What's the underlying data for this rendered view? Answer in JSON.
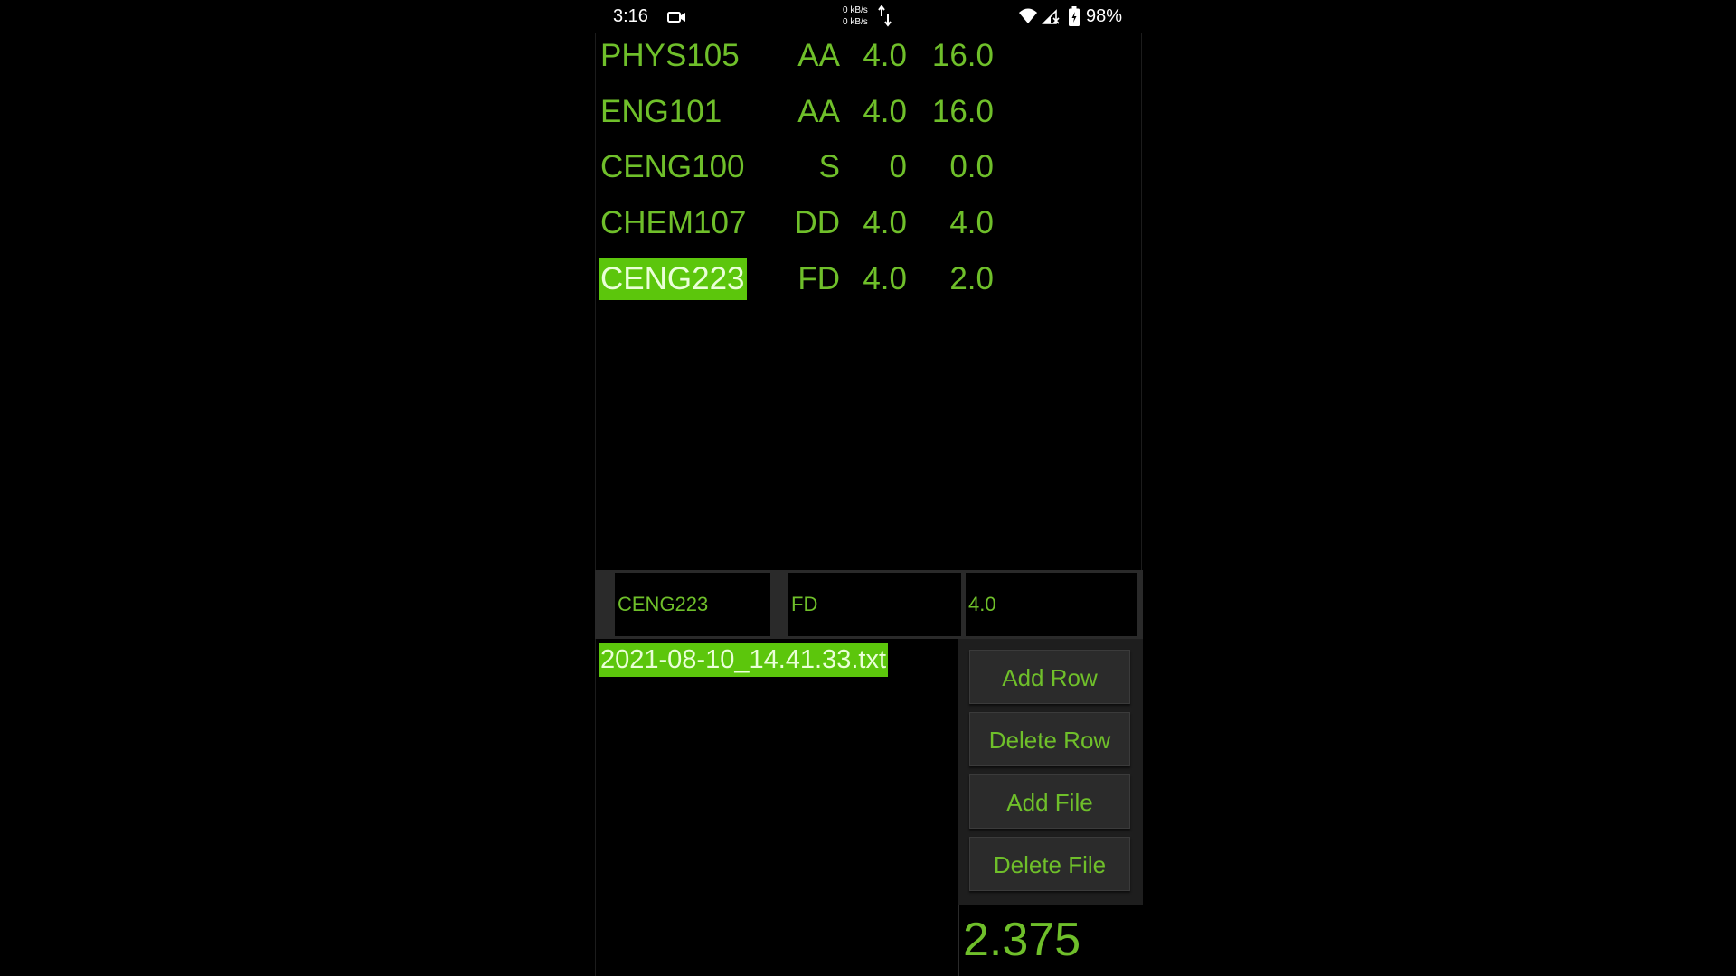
{
  "status_bar": {
    "time": "3:16",
    "net_up": "0 kB/s",
    "net_down": "0 kB/s",
    "battery_percent": "98%",
    "icons": [
      "screen-record-icon",
      "data-arrows-icon",
      "wifi-icon",
      "signal-icon",
      "battery-charging-icon"
    ]
  },
  "courses": [
    {
      "code": "PHYS105",
      "grade": "AA",
      "credit": "4.0",
      "points": "16.0",
      "selected": false
    },
    {
      "code": "ENG101",
      "grade": "AA",
      "credit": "4.0",
      "points": "16.0",
      "selected": false
    },
    {
      "code": "CENG100",
      "grade": "S",
      "credit": "0",
      "points": "0.0",
      "selected": false
    },
    {
      "code": "CHEM107",
      "grade": "DD",
      "credit": "4.0",
      "points": "4.0",
      "selected": false
    },
    {
      "code": "CENG223",
      "grade": "FD",
      "credit": "4.0",
      "points": "2.0",
      "selected": true
    }
  ],
  "edit": {
    "code_value": "CENG223",
    "grade_value": "FD",
    "credit_value": "4.0"
  },
  "files": [
    {
      "name": "2021-08-10_14.41.33.txt",
      "selected": true
    }
  ],
  "buttons": {
    "add_row": "Add Row",
    "delete_row": "Delete Row",
    "add_file": "Add File",
    "delete_file": "Delete File"
  },
  "gpa": "2.375",
  "colors": {
    "text_green": "#6fbf2a",
    "highlight_green": "#5cc60c",
    "background": "#000000"
  }
}
